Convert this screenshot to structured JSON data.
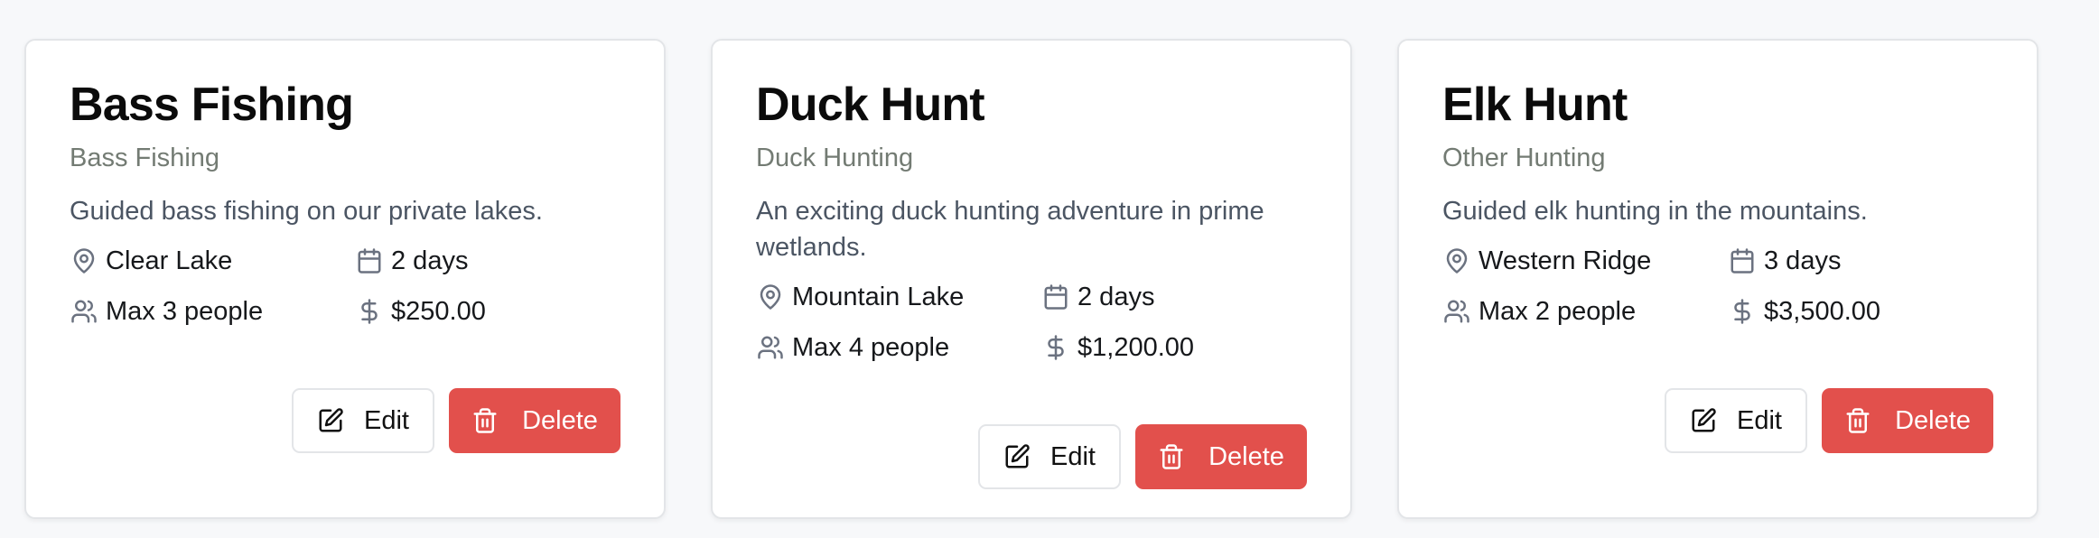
{
  "colors": {
    "page_background": "#f7f8fa",
    "card_background": "#ffffff",
    "delete_button": "#e2504c",
    "muted_text": "#737b73"
  },
  "cards": [
    {
      "title": "Bass Fishing",
      "category": "Bass Fishing",
      "description": "Guided bass fishing on our private lakes.",
      "location": "Clear Lake",
      "duration": "2 days",
      "capacity": "Max 3 people",
      "price": "$250.00",
      "edit_label": "Edit",
      "delete_label": "Delete"
    },
    {
      "title": "Duck Hunt",
      "category": "Duck Hunting",
      "description": "An exciting duck hunting adventure in prime wetlands.",
      "location": "Mountain Lake",
      "duration": "2 days",
      "capacity": "Max 4 people",
      "price": "$1,200.00",
      "edit_label": "Edit",
      "delete_label": "Delete"
    },
    {
      "title": "Elk Hunt",
      "category": "Other Hunting",
      "description": "Guided elk hunting in the mountains.",
      "location": "Western Ridge",
      "duration": "3 days",
      "capacity": "Max 2 people",
      "price": "$3,500.00",
      "edit_label": "Edit",
      "delete_label": "Delete"
    }
  ],
  "icons": {
    "location": "map-pin-icon",
    "duration": "calendar-icon",
    "capacity": "users-icon",
    "price": "dollar-sign-icon",
    "edit": "edit-icon",
    "delete": "trash-icon"
  }
}
